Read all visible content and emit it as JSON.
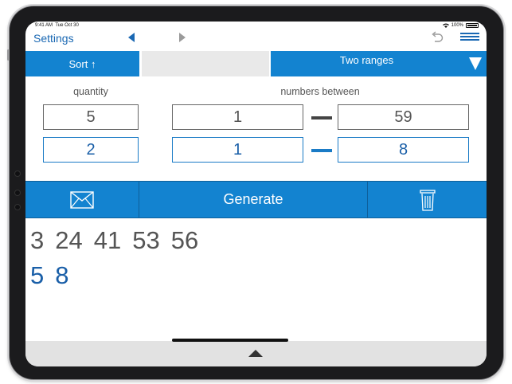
{
  "status_bar": {
    "time": "9:41 AM",
    "date": "Tue Oct 30",
    "battery": "100%"
  },
  "nav": {
    "settings_label": "Settings",
    "prev_icon": "triangle-left-icon",
    "next_icon": "triangle-right-icon",
    "undo_icon": "undo-icon",
    "menu_icon": "hamburger-menu-icon"
  },
  "options": {
    "sort_label": "Sort ↑",
    "mode_label": "Two ranges",
    "mode_icon": "dropdown-triangle-icon"
  },
  "inputs": {
    "quantity_label": "quantity",
    "between_label": "numbers between",
    "range1": {
      "quantity": "5",
      "from": "1",
      "to": "59"
    },
    "range2": {
      "quantity": "2",
      "from": "1",
      "to": "8"
    }
  },
  "actions": {
    "mail_icon": "envelope-icon",
    "generate_label": "Generate",
    "trash_icon": "trash-can-icon"
  },
  "results": {
    "main_numbers": [
      "3",
      "24",
      "41",
      "53",
      "56"
    ],
    "bonus_numbers": [
      "5",
      "8"
    ]
  },
  "bottom": {
    "expand_icon": "chevron-up-icon"
  },
  "colors": {
    "accent": "#1383d0",
    "blue_text": "#1a5fa8",
    "gray_text": "#555555"
  }
}
